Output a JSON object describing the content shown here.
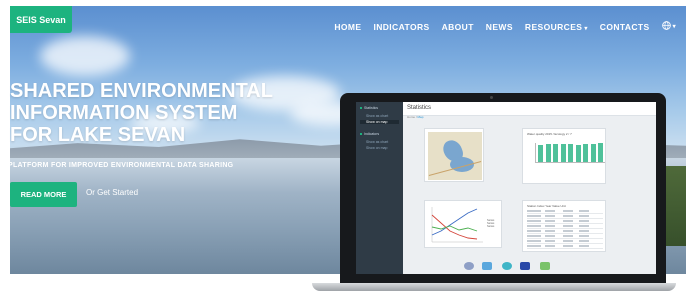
{
  "logo": {
    "label": "SEIS Sevan"
  },
  "nav": {
    "items": [
      {
        "label": "HOME",
        "has_caret": false
      },
      {
        "label": "INDICATORS",
        "has_caret": false
      },
      {
        "label": "ABOUT",
        "has_caret": false
      },
      {
        "label": "NEWS",
        "has_caret": false
      },
      {
        "label": "RESOURCES",
        "has_caret": true
      },
      {
        "label": "CONTACTS",
        "has_caret": false
      }
    ],
    "caret_glyph": "▾",
    "globe_icon": "globe-icon"
  },
  "hero": {
    "title_lines": [
      "SHARED ENVIRONMENTAL",
      "INFORMATION SYSTEM",
      "FOR LAKE SEVAN"
    ],
    "subtitle": "PLATFORM FOR IMPROVED ENVIRONMENTAL DATA SHARING",
    "primary_button": "READ MORE",
    "secondary_link": "Or Get Started"
  },
  "laptop_screen": {
    "title": "Statistics",
    "breadcrumb": {
      "home": "Home",
      "current": "Map"
    },
    "sidebar": [
      {
        "label": "Statistics",
        "type": "header"
      },
      {
        "label": "Show as chart",
        "type": "sub"
      },
      {
        "label": "Show on map",
        "type": "active"
      },
      {
        "label": "Indicators",
        "type": "header"
      },
      {
        "label": "Show as chart",
        "type": "sub"
      },
      {
        "label": "Show on map",
        "type": "sub"
      }
    ],
    "bar_card_title": "Water quality 2015 / Ecology 2 / 7",
    "bar_values": [
      0.85,
      0.9,
      0.88,
      0.92,
      0.9,
      0.87,
      0.91,
      0.89,
      0.93
    ],
    "line_card_legend": [
      "Series",
      "Series",
      "Series"
    ],
    "table_card_title": "Station  Index  Year  Value  Unit"
  },
  "colors": {
    "accent": "#1db37f",
    "nav_text": "#ffffff",
    "sidebar_dark": "#2f3b46"
  }
}
